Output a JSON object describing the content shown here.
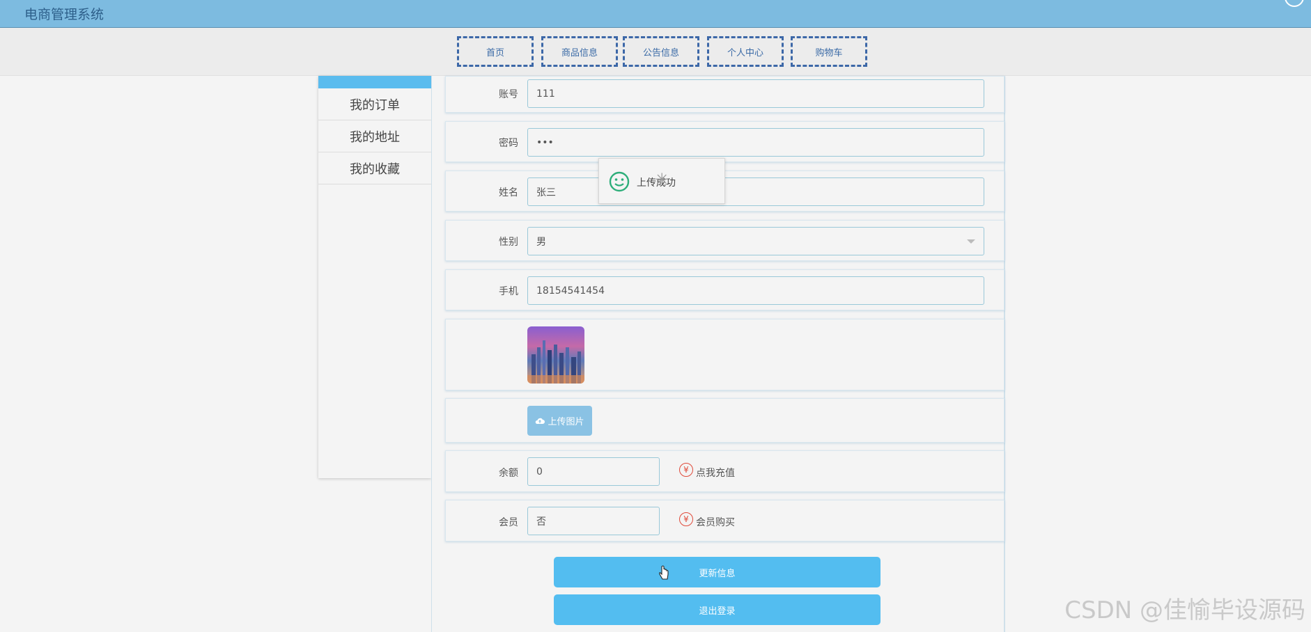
{
  "app": {
    "title": "电商管理系统"
  },
  "nav": {
    "items": [
      "首页",
      "商品信息",
      "公告信息",
      "个人中心",
      "购物车"
    ]
  },
  "sidebar": {
    "items": [
      "我的订单",
      "我的地址",
      "我的收藏"
    ]
  },
  "form": {
    "account": {
      "label": "账号",
      "value": "111"
    },
    "password": {
      "label": "密码",
      "value": "•••"
    },
    "name": {
      "label": "姓名",
      "value": "张三"
    },
    "gender": {
      "label": "性别",
      "value": "男"
    },
    "phone": {
      "label": "手机",
      "value": "18154541454"
    },
    "upload_label": "上传图片",
    "balance": {
      "label": "余额",
      "value": "0",
      "link": "点我充值"
    },
    "member": {
      "label": "会员",
      "value": "否",
      "link": "会员购买"
    }
  },
  "buttons": {
    "update": "更新信息",
    "logout": "退出登录"
  },
  "toast": {
    "message": "上传成功"
  },
  "watermark": "CSDN @佳愉毕设源码",
  "icons": {
    "toast": "smile-icon",
    "yen": "yen-icon",
    "upload": "cloud-upload-icon"
  },
  "colors": {
    "topbar": "#7dbbe0",
    "accent": "#53bdf0",
    "nav_border": "#3d68a8"
  }
}
